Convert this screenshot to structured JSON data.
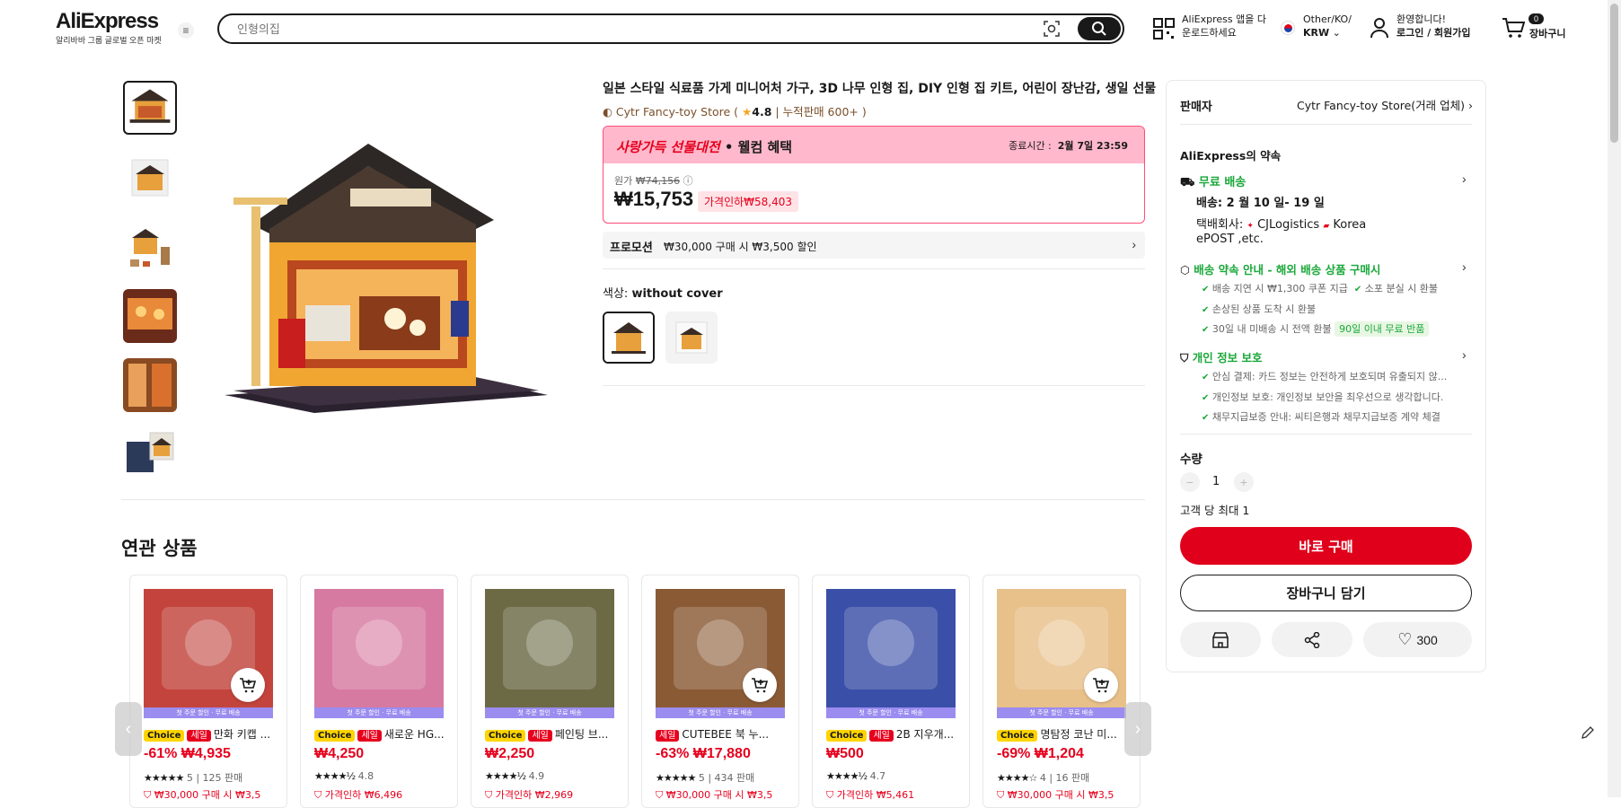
{
  "header": {
    "logo": "AliExpress",
    "logo_sub": "알리바바 그룹 글로벌 오픈 마켓",
    "search_placeholder": "인형의집",
    "app_download": [
      "AliExpress 앱을 다",
      "운로드하세요"
    ],
    "locale_top": "Other/KO/",
    "currency": "KRW",
    "greeting": "환영합니다!",
    "login": "로그인 / 회원가입",
    "cart_count": "0",
    "cart_label": "장바구니"
  },
  "product": {
    "title": "일본 스타일 식료품 가게 미니어처 가구, 3D 나무 인형 집, DIY 인형 집 키트, 어린이 장난감, 생일 선물",
    "store": "Cytr Fancy-toy Store",
    "rating": "4.8",
    "sold": "누적판매 600+",
    "sale_title": "사랑가득 선물대전",
    "sale_sub": "• 웰컴 혜택",
    "end_label": "종료시간 :",
    "end_time": "2월 7일 23:59",
    "orig_label": "원가",
    "orig_price": "₩74,156",
    "price": "₩15,753",
    "discount": "가격인하₩58,403",
    "promo_label": "프로모션",
    "promo_text": "₩30,000 구매 시 ₩3,500 할인",
    "color_label": "색상:",
    "color_value": "without cover"
  },
  "panel": {
    "seller_label": "판매자",
    "seller_name": "Cytr Fancy-toy Store(거래 업체)",
    "promise_title": "AliExpress의 약속",
    "free_ship": "무료 배송",
    "delivery": "배송: 2 월 10 일- 19 일",
    "carrier_label": "택배회사:",
    "carrier1": "CJLogistics",
    "carrier2": "Korea",
    "carrier3": "ePOST ,etc.",
    "guarantee_title": "배송 약속 안내 - 해외 배송 상품 구매시",
    "g1": "배송 지연 시 ₩1,300 쿠폰 지급",
    "g2": "소포 분실 시 환불",
    "g3": "손상된 상품 도착 시 환불",
    "g4": "30일 내 미배송 시 전액 환불",
    "g4_tag": "90일 이내 무료 반품",
    "privacy_title": "개인 정보 보호",
    "p1": "안심 결제: 카드 정보는 안전하게 보호되며 유출되지 않...",
    "p2": "개인정보 보호: 개인정보 보안을 최우선으로 생각합니다.",
    "p3": "채무지급보증 안내: 씨티은행과 채무지급보증 계약 체결",
    "qty_label": "수량",
    "qty": "1",
    "qty_max": "고객 당 최대 1",
    "buy": "바로 구매",
    "add_cart": "장바구니 담기",
    "wish_count": "300"
  },
  "related": {
    "title": "연관 상품",
    "strip_text": "첫 주문 할인 · 무료 배송",
    "items": [
      {
        "choice": "Choice",
        "sale": "세일",
        "name": "만화 키캡 ...",
        "price": "-61% ₩4,935",
        "stars": "★★★★★",
        "rating": "5",
        "sold": "| 125 판매",
        "foot": "₩30,000 구매 시 ₩3,5",
        "color": "#c3443c",
        "cart": true
      },
      {
        "choice": "Choice",
        "sale": "세일",
        "name": "새로운 HG...",
        "price": "₩4,250",
        "stars": "★★★★½",
        "rating": "4.8",
        "sold": "",
        "foot": "가격인하 ₩6,496",
        "color": "#d77aa2",
        "cart": false
      },
      {
        "choice": "Choice",
        "sale": "세일",
        "name": "페인팅 브...",
        "price": "₩2,250",
        "stars": "★★★★½",
        "rating": "4.9",
        "sold": "",
        "foot": "가격인하 ₩2,969",
        "color": "#6b6a45",
        "cart": false
      },
      {
        "choice": "",
        "sale": "세일",
        "name": "CUTEBEE 북 누...",
        "price": "-63% ₩17,880",
        "stars": "★★★★★",
        "rating": "5",
        "sold": "| 434 판매",
        "foot": "₩30,000 구매 시 ₩3,5",
        "color": "#8a5a35",
        "cart": true
      },
      {
        "choice": "Choice",
        "sale": "세일",
        "name": "2B 지우개...",
        "price": "₩500",
        "stars": "★★★★½",
        "rating": "4.7",
        "sold": "",
        "foot": "가격인하 ₩5,461",
        "color": "#3a4fa8",
        "cart": false
      },
      {
        "choice": "Choice",
        "sale": "",
        "name": "명탐정 코난 미...",
        "price": "-69% ₩1,204",
        "stars": "★★★★☆",
        "rating": "4",
        "sold": "| 16 판매",
        "foot": "₩30,000 구매 시 ₩3,5",
        "color": "#e8c08a",
        "cart": true
      }
    ]
  },
  "colors": {
    "accent": "#e0001b",
    "green": "#1aa83a",
    "sale_pink": "#ffb8cc"
  }
}
